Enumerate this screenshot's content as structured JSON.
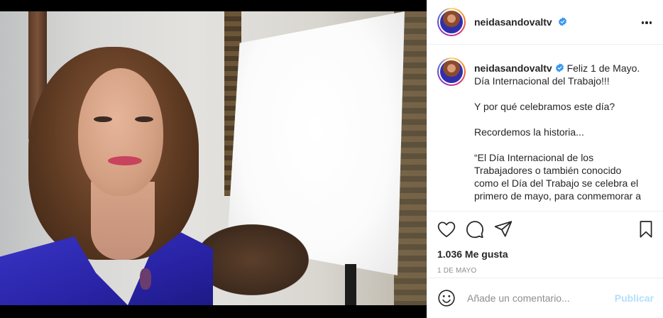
{
  "post": {
    "media": {
      "description_icon": "post-photo"
    },
    "header": {
      "username": "neidasandovaltv",
      "verified_icon": "verified-badge-icon",
      "more_icon": "more-options-icon"
    },
    "caption": {
      "username": "neidasandovaltv",
      "lines": [
        "Feliz 1 de Mayo.",
        "Día Internacional del Trabajo!!!",
        "",
        "Y por qué celebramos este día?",
        "",
        "Recordemos la historia...",
        "",
        "“El Día Internacional de los",
        "Trabajadores o también conocido",
        "como el Día del Trabajo se celebra el",
        "primero de mayo, para conmemorar a"
      ]
    },
    "actions": {
      "like_icon": "heart-icon",
      "comment_icon": "comment-icon",
      "share_icon": "share-icon",
      "save_icon": "bookmark-icon",
      "likes": "1.036 Me gusta",
      "date": "1 DE MAYO"
    },
    "add_comment": {
      "emoji_icon": "emoji-icon",
      "placeholder": "Añade un comentario...",
      "publish_label": "Publicar"
    }
  },
  "colors": {
    "verified": "#3897f0",
    "publish_disabled": "#b2dffc",
    "muted": "#8e8e8e"
  }
}
